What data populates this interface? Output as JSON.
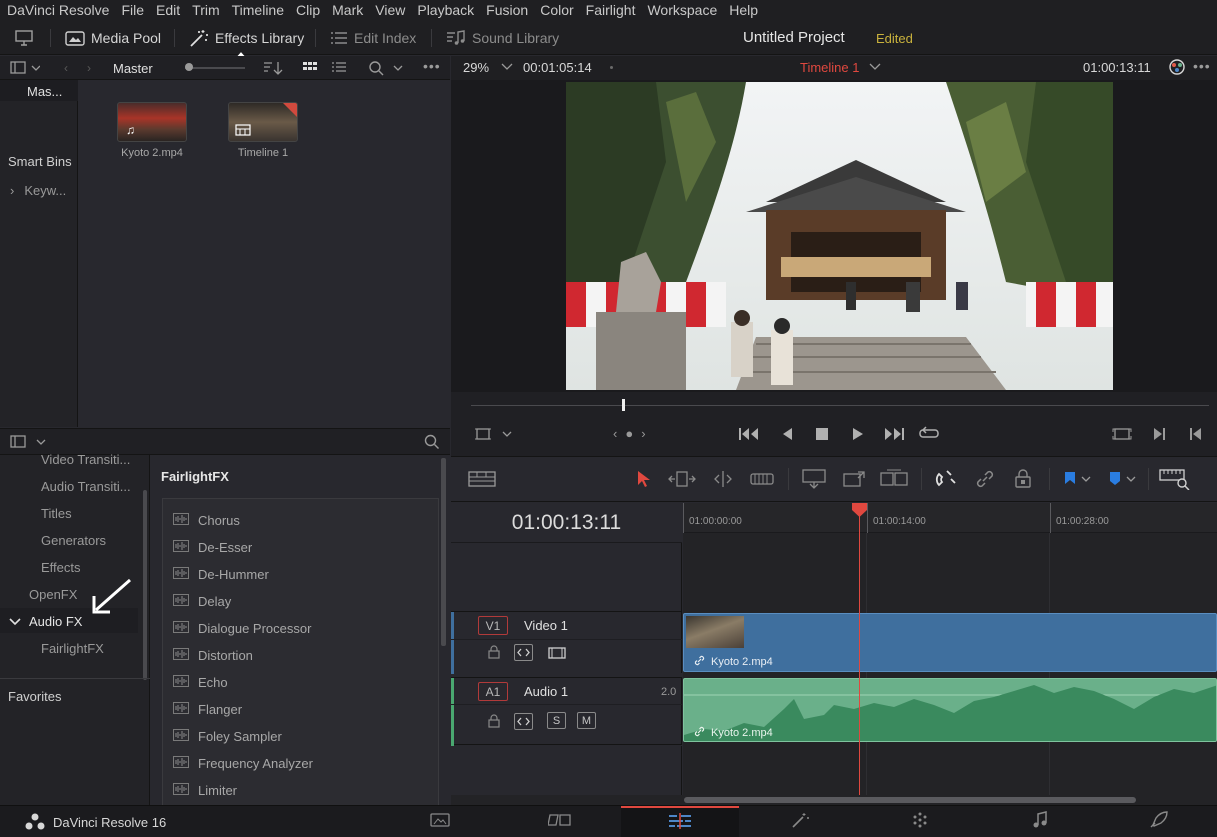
{
  "menu": [
    "DaVinci Resolve",
    "File",
    "Edit",
    "Trim",
    "Timeline",
    "Clip",
    "Mark",
    "View",
    "Playback",
    "Fusion",
    "Color",
    "Fairlight",
    "Workspace",
    "Help"
  ],
  "toolbar": {
    "media_pool": "Media Pool",
    "effects_library": "Effects Library",
    "edit_index": "Edit Index",
    "sound_library": "Sound Library",
    "project_title": "Untitled Project",
    "edited_status": "Edited"
  },
  "media_pool": {
    "bin_name": "Master",
    "bins": [
      "Mas..."
    ],
    "smart_bins_label": "Smart Bins",
    "smart_bins": [
      "Keyw..."
    ],
    "clips": [
      {
        "name": "Kyoto 2.mp4"
      },
      {
        "name": "Timeline 1"
      }
    ]
  },
  "effects": {
    "tree": [
      "Video Transiti...",
      "Audio Transiti...",
      "Titles",
      "Generators",
      "Effects",
      "OpenFX",
      "Audio FX",
      "FairlightFX"
    ],
    "favorites_label": "Favorites",
    "category_title": "FairlightFX",
    "items": [
      "Chorus",
      "De-Esser",
      "De-Hummer",
      "Delay",
      "Dialogue Processor",
      "Distortion",
      "Echo",
      "Flanger",
      "Foley Sampler",
      "Frequency Analyzer",
      "Limiter"
    ]
  },
  "viewer": {
    "zoom": "29%",
    "duration_tc": "00:01:05:14",
    "timeline_name": "Timeline 1",
    "current_tc": "01:00:13:11",
    "scrub_position": 0.205
  },
  "timeline": {
    "timecode": "01:00:13:11",
    "ruler_marks": [
      "01:00:00:00",
      "01:00:14:00",
      "01:00:28:00"
    ],
    "video_track": {
      "badge": "V1",
      "name": "Video 1",
      "clip": "Kyoto 2.mp4"
    },
    "audio_track": {
      "badge": "A1",
      "name": "Audio 1",
      "channels": "2.0",
      "solo": "S",
      "mute": "M",
      "clip": "Kyoto 2.mp4"
    }
  },
  "app": {
    "name": "DaVinci Resolve 16"
  },
  "colors": {
    "accent_red": "#e0483f",
    "video_clip": "#3f6f9e",
    "audio_clip": "#6ab08a",
    "edited": "#c9b23d"
  }
}
